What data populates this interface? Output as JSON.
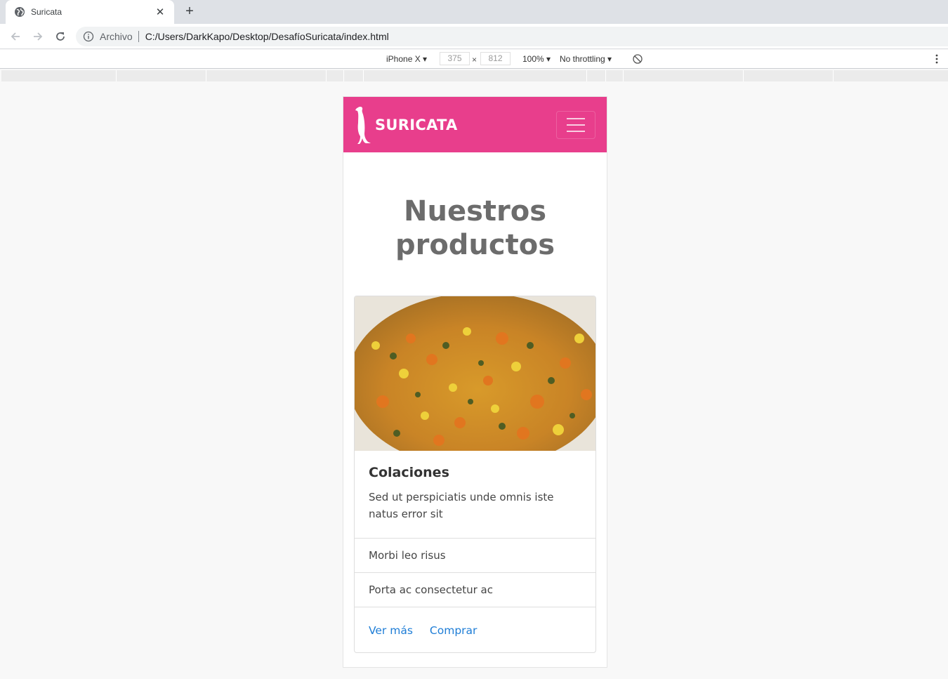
{
  "browser": {
    "tab_title": "Suricata",
    "tab_close": "✕",
    "new_tab": "+",
    "security_label": "Archivo",
    "url": "C:/Users/DarkKapo/Desktop/DesafíoSuricata/index.html"
  },
  "devtools": {
    "device": "iPhone X ▾",
    "width": "375",
    "times": "×",
    "height": "812",
    "zoom": "100% ▾",
    "throttling": "No throttling ▾"
  },
  "page": {
    "brand": "SURICATA",
    "brand_color": "#e83e8c",
    "heading_line1": "Nuestros",
    "heading_line2": "productos",
    "card": {
      "title": "Colaciones",
      "text": "Sed ut perspiciatis unde omnis iste natus error sit",
      "list_items": [
        "Morbi leo risus",
        "Porta ac consectetur ac"
      ],
      "links": [
        "Ver más",
        "Comprar"
      ]
    }
  }
}
